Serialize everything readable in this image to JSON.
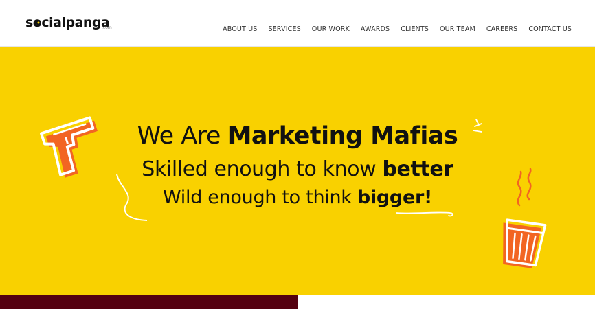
{
  "brand": {
    "name": "socialpanga",
    "suffix": ".com"
  },
  "nav": {
    "items": [
      {
        "label": "ABOUT US"
      },
      {
        "label": "SERVICES"
      },
      {
        "label": "OUR WORK"
      },
      {
        "label": "AWARDS"
      },
      {
        "label": "CLIENTS"
      },
      {
        "label": "OUR TEAM"
      },
      {
        "label": "CAREERS"
      },
      {
        "label": "CONTACT US"
      }
    ]
  },
  "hero": {
    "line1": {
      "pre": "We Are ",
      "bold": "Marketing Mafias"
    },
    "line2": {
      "pre": "Skilled enough to know ",
      "bold": "better"
    },
    "line3": {
      "pre": "Wild enough to think ",
      "bold": "bigger!"
    }
  },
  "colors": {
    "hero_bg": "#f9d100",
    "accent_orange": "#f26522",
    "bottom_dark": "#540010"
  },
  "icons": {
    "left": "gun-icon",
    "right": "tea-glass-icon"
  }
}
